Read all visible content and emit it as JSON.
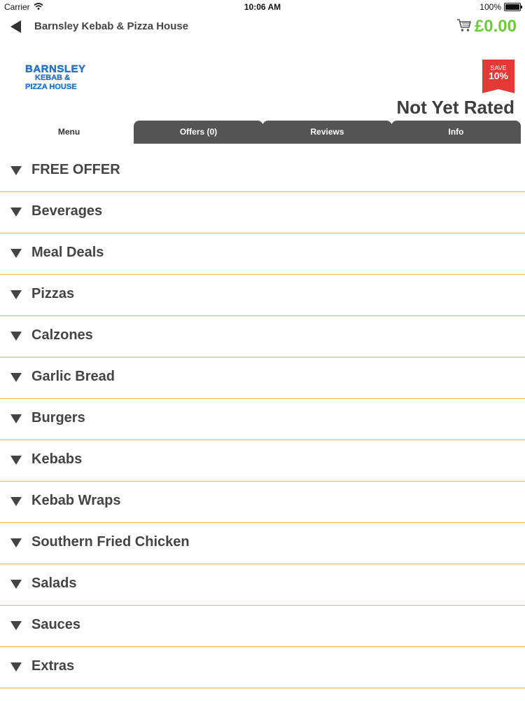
{
  "status_bar": {
    "carrier": "Carrier",
    "time": "10:06 AM",
    "battery": "100%"
  },
  "nav": {
    "title": "Barnsley Kebab & Pizza House",
    "cart_total": "£0.00",
    "cart_total_color": "#6fc93b"
  },
  "header": {
    "logo_line1": "BARNSLEY",
    "logo_line2": "KEBAB &",
    "logo_line3": "PIZZA HOUSE",
    "save_badge_small": "SAVE",
    "save_badge_big": "10%",
    "rating_text": "Not Yet Rated"
  },
  "tabs": [
    {
      "label": "Menu",
      "active": true
    },
    {
      "label": "Offers (0)",
      "active": false
    },
    {
      "label": "Reviews",
      "active": false
    },
    {
      "label": "Info",
      "active": false
    }
  ],
  "categories": [
    {
      "label": "FREE OFFER"
    },
    {
      "label": "Beverages"
    },
    {
      "label": "Meal Deals"
    },
    {
      "label": "Pizzas"
    },
    {
      "label": "Calzones"
    },
    {
      "label": "Garlic Bread"
    },
    {
      "label": "Burgers"
    },
    {
      "label": "Kebabs"
    },
    {
      "label": "Kebab Wraps"
    },
    {
      "label": "Southern Fried Chicken"
    },
    {
      "label": "Salads"
    },
    {
      "label": "Sauces"
    },
    {
      "label": "Extras"
    }
  ],
  "colors": {
    "accent_divider": "#f5b944",
    "tab_inactive": "#555555",
    "badge_red": "#e53935"
  }
}
